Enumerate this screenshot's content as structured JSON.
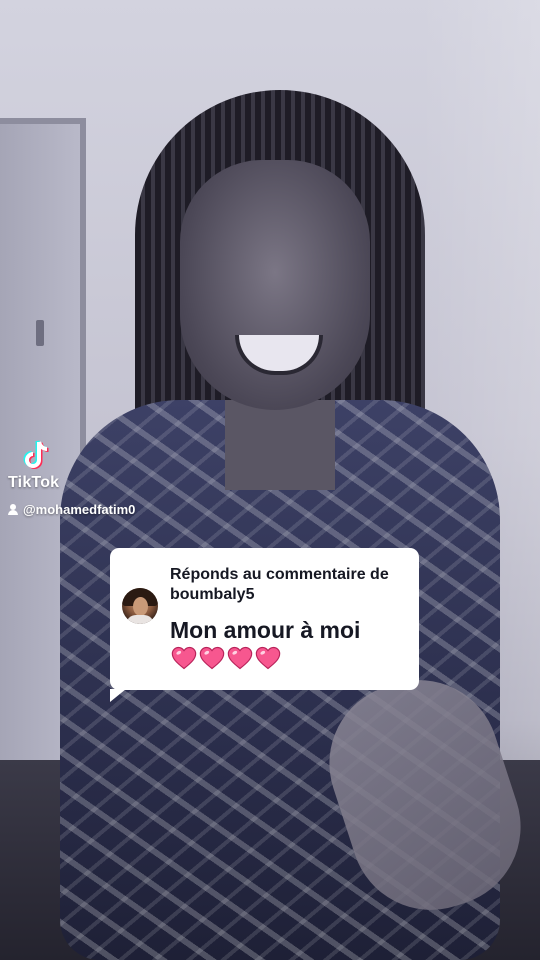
{
  "watermark": {
    "brand": "TikTok",
    "username": "@mohamedfatim0"
  },
  "reply_sticker": {
    "header": "Réponds au commentaire de boumbaly5",
    "comment": "Mon amour à moi",
    "heart_count": 4,
    "heart_color": "#f7578f"
  },
  "icons": {
    "brand_logo": "tiktok-logo-icon",
    "user": "user-icon",
    "heart": "pink-heart-icon"
  }
}
